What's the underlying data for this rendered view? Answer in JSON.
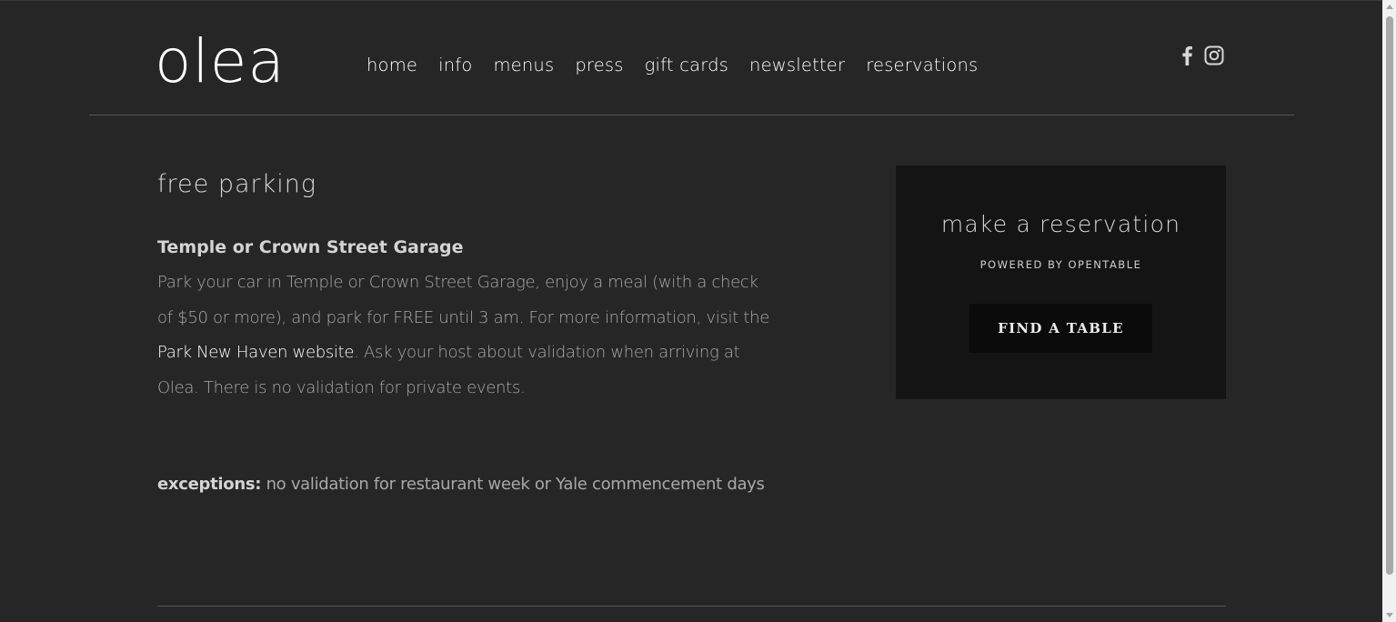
{
  "header": {
    "logo_text": "olea",
    "nav": [
      {
        "label": "home"
      },
      {
        "label": "info"
      },
      {
        "label": "menus"
      },
      {
        "label": "press"
      },
      {
        "label": "gift cards"
      },
      {
        "label": "newsletter"
      },
      {
        "label": "reservations"
      }
    ],
    "social": [
      {
        "icon": "facebook-icon"
      },
      {
        "icon": "instagram-icon"
      }
    ]
  },
  "main": {
    "section_title": "free parking",
    "garage_heading": "Temple or Crown Street Garage",
    "body_before_link": "Park your car in Temple or Crown Street Garage, enjoy a meal (with a check of $50 or more), and park for FREE until 3 am. For more information, visit the ",
    "body_link": "Park New Haven website",
    "body_after_link": ". Ask your host about validation when arriving at Olea. There is no validation for private events.",
    "exceptions_label": "exceptions:",
    "exceptions_text": " no validation for restaurant week or Yale commencement days"
  },
  "reservation": {
    "title": "make a reservation",
    "powered_by": "POWERED BY OPENTABLE",
    "button_label": "FIND A TABLE"
  },
  "colors": {
    "background": "#262626",
    "panel": "#141414",
    "button": "#0b0b0b",
    "text_muted": "#a9a9a9",
    "link": "#ffffff"
  }
}
